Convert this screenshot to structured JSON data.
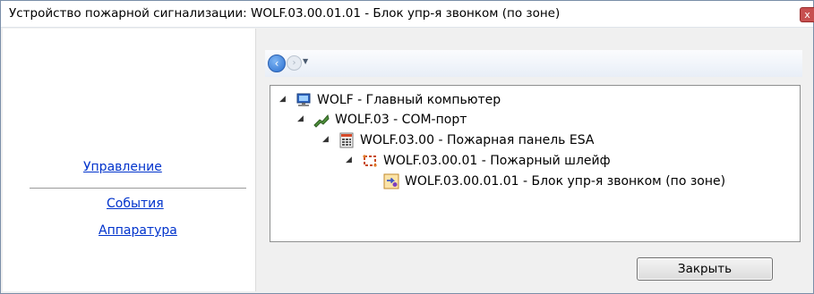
{
  "window": {
    "title": "Устройство пожарной сигнализации: WOLF.03.00.01.01 - Блок упр-я звонком (по зоне)",
    "close_glyph": "x"
  },
  "sidebar": {
    "links": [
      {
        "label": "Управление"
      },
      {
        "label": "События"
      },
      {
        "label": "Аппаратура"
      }
    ]
  },
  "navigation": {
    "back_glyph": "‹",
    "forward_glyph": "›",
    "dropdown_glyph": "▼"
  },
  "tree": {
    "nodes": [
      {
        "label": "WOLF - Главный компьютер",
        "icon": "computer-icon",
        "expanded": true
      },
      {
        "label": "WOLF.03 - COM-порт",
        "icon": "com-port-icon",
        "expanded": true
      },
      {
        "label": "WOLF.03.00 - Пожарная панель ESA",
        "icon": "fire-panel-icon",
        "expanded": true
      },
      {
        "label": "WOLF.03.00.01 - Пожарный шлейф",
        "icon": "fire-loop-icon",
        "expanded": true
      },
      {
        "label": "WOLF.03.00.01.01 - Блок упр-я звонком (по зоне)",
        "icon": "bell-control-module-icon",
        "expanded": false
      }
    ],
    "expanded_glyph": "◢"
  },
  "footer": {
    "close_label": "Закрыть"
  },
  "colors": {
    "link": "#0033cc",
    "close_red": "#c75050",
    "nav_blue": "#2a6fd0"
  }
}
